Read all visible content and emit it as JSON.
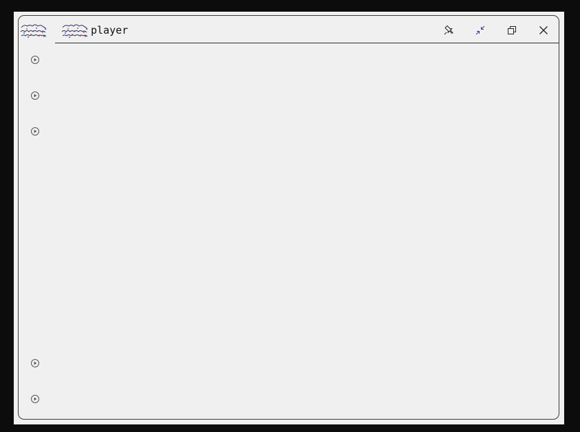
{
  "window": {
    "tab_title": "player"
  },
  "title_bar": {
    "controls": [
      {
        "name": "pin",
        "icon": "pin-icon"
      },
      {
        "name": "shrink",
        "icon": "shrink-icon",
        "color": "#2b3f8f"
      },
      {
        "name": "restore",
        "icon": "restore-icon"
      },
      {
        "name": "close",
        "icon": "close-icon"
      }
    ]
  },
  "sidebar": {
    "items": [
      {
        "icon": "play-circle-icon"
      },
      {
        "icon": "play-circle-icon"
      },
      {
        "icon": "play-circle-icon"
      },
      {
        "icon": "play-circle-icon"
      },
      {
        "icon": "play-circle-icon"
      }
    ]
  },
  "colors": {
    "window_bg": "#f0f0f0",
    "desktop_bg": "#0c0c0c",
    "border": "#3a3a3a",
    "accent": "#2b3f8f"
  }
}
